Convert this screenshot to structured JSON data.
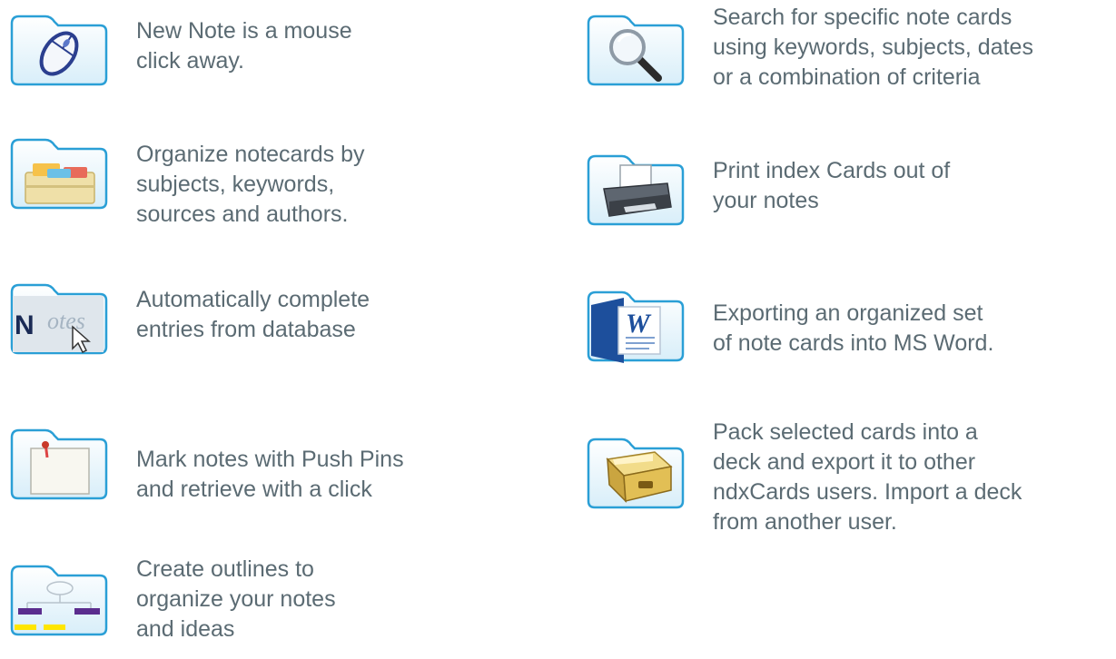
{
  "features": [
    {
      "icon": "mouse-icon",
      "lines": [
        "New Note is a mouse",
        "click away."
      ]
    },
    {
      "icon": "card-file-icon",
      "lines": [
        "Organize notecards by",
        "subjects, keywords,",
        "sources and authors."
      ]
    },
    {
      "icon": "notes-autocomplete-icon",
      "icon_text": "N otes",
      "lines": [
        "Automatically complete",
        "entries from database"
      ]
    },
    {
      "icon": "push-pin-icon",
      "lines": [
        "Mark notes with Push Pins",
        "and retrieve with a click"
      ]
    },
    {
      "icon": "outline-icon",
      "lines": [
        "Create outlines to",
        "organize your notes",
        "and ideas"
      ]
    },
    {
      "icon": "magnifier-icon",
      "lines": [
        "Search for specific note cards",
        "using keywords, subjects, dates",
        "or a combination of criteria"
      ]
    },
    {
      "icon": "printer-icon",
      "lines": [
        "Print index Cards out of",
        "your notes"
      ]
    },
    {
      "icon": "word-icon",
      "icon_text": "W",
      "lines": [
        "Exporting an organized set",
        "of note cards into MS Word."
      ]
    },
    {
      "icon": "card-deck-icon",
      "lines": [
        "Pack selected cards into a",
        "deck and export it to other",
        "ndxCards users. Import a deck",
        "from another user."
      ]
    }
  ],
  "colors": {
    "text": "#5b6b73",
    "folder_border": "#2a9fd6",
    "folder_fill": "#e9f6fd",
    "outline_purple": "#5b2d8e",
    "outline_yellow": "#ffe600"
  }
}
